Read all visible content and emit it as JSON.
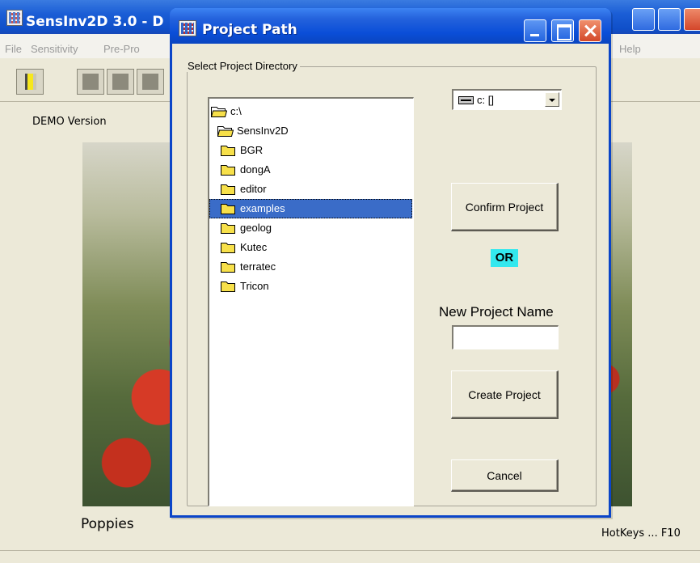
{
  "main_window": {
    "title": "SensInv2D 3.0 - D",
    "menu": [
      "File",
      "Sensitivity",
      "Pre-Pro",
      "Help"
    ],
    "demo_label": "DEMO Version",
    "photo_caption": "Poppies",
    "hotkeys": "HotKeys ... F10"
  },
  "dialog": {
    "title": "Project Path",
    "group_label": "Select Project Directory",
    "tree": [
      {
        "label": "c:\\",
        "open": true,
        "selected": false
      },
      {
        "label": "SensInv2D",
        "open": true,
        "selected": false
      },
      {
        "label": "BGR",
        "open": false,
        "selected": false
      },
      {
        "label": "dongA",
        "open": false,
        "selected": false
      },
      {
        "label": "editor",
        "open": false,
        "selected": false
      },
      {
        "label": "examples",
        "open": false,
        "selected": true
      },
      {
        "label": "geolog",
        "open": false,
        "selected": false
      },
      {
        "label": "Kutec",
        "open": false,
        "selected": false
      },
      {
        "label": "terratec",
        "open": false,
        "selected": false
      },
      {
        "label": "Tricon",
        "open": false,
        "selected": false
      }
    ],
    "drive": "c: []",
    "confirm_button": "Confirm Project",
    "or_label": "OR",
    "new_project_label": "New Project Name",
    "new_project_value": "",
    "create_button": "Create Project",
    "cancel_button": "Cancel"
  },
  "colors": {
    "titlebar": "#0a4ed8",
    "selection": "#3a6cc8",
    "or_highlight": "#33e8ee",
    "folder": "#f7e04a"
  }
}
